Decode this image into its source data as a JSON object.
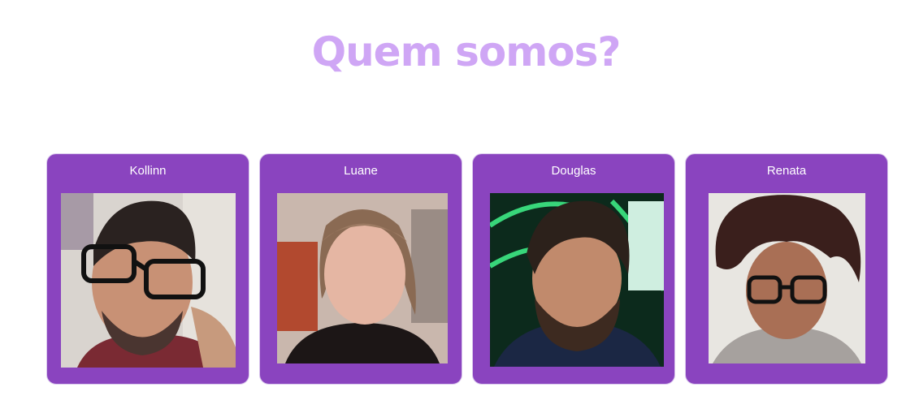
{
  "heading": "Quem somos?",
  "colors": {
    "heading": "#cfa6f5",
    "card_bg": "#8a44bf"
  },
  "members": [
    {
      "name": "Kollinn"
    },
    {
      "name": "Luane"
    },
    {
      "name": "Douglas"
    },
    {
      "name": "Renata"
    }
  ]
}
